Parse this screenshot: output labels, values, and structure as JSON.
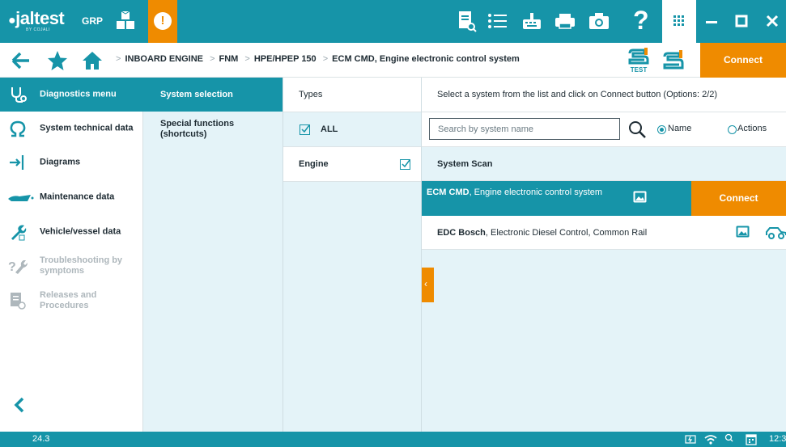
{
  "topbar": {
    "logo": "jaltest",
    "logo_sub": "BY COJALI",
    "grp_label": "GRP",
    "alert_glyph": "!",
    "help_glyph": "?",
    "icons": [
      "cubes-icon",
      "alert-icon",
      "document-search-icon",
      "list-icon",
      "keyboard-icon",
      "printer-icon",
      "camera-icon",
      "help-icon",
      "apps-grid-icon",
      "minimize-icon",
      "maximize-icon",
      "close-icon"
    ],
    "colors": {
      "bar": "#1694a8",
      "accent": "#ef8b00"
    }
  },
  "nav": {
    "breadcrumb": [
      "INBOARD ENGINE",
      "FNM",
      "HPE/HPEP 150",
      "ECM CMD, Engine electronic control system"
    ],
    "test_label": "TEST",
    "connect_label": "Connect"
  },
  "sidebar": {
    "items": [
      {
        "label": "Diagnostics menu",
        "icon": "stethoscope-icon",
        "active": true
      },
      {
        "label": "System technical data",
        "icon": "omega-icon"
      },
      {
        "label": "Diagrams",
        "icon": "diagram-icon"
      },
      {
        "label": "Maintenance data",
        "icon": "oil-can-icon"
      },
      {
        "label": "Vehicle/vessel data",
        "icon": "wrench-icon"
      },
      {
        "label": "Troubleshooting by symptoms",
        "icon": "troubleshooting-icon",
        "disabled": true
      },
      {
        "label": "Releases and Procedures",
        "icon": "releases-icon",
        "disabled": true
      }
    ]
  },
  "col2": {
    "items": [
      {
        "label": "System selection",
        "active": true
      },
      {
        "label": "Special functions (shortcuts)"
      }
    ]
  },
  "types": {
    "header": "Types",
    "all_label": "ALL",
    "items": [
      {
        "label": "Engine",
        "checked": true
      }
    ]
  },
  "main": {
    "info": "Select a system from the list and click on Connect button (Options: 2/2)",
    "search_placeholder": "Search by system name",
    "radio_name": "Name",
    "radio_actions": "Actions",
    "scan_label": "System Scan",
    "systems": [
      {
        "code": "ECM CMD",
        "desc": ", Engine electronic control system",
        "selected": true
      },
      {
        "code": "EDC Bosch",
        "desc": ", Electronic Diesel Control, Common Rail"
      }
    ],
    "connect_label": "Connect"
  },
  "status": {
    "version": "24.3",
    "clock": "12:3"
  }
}
